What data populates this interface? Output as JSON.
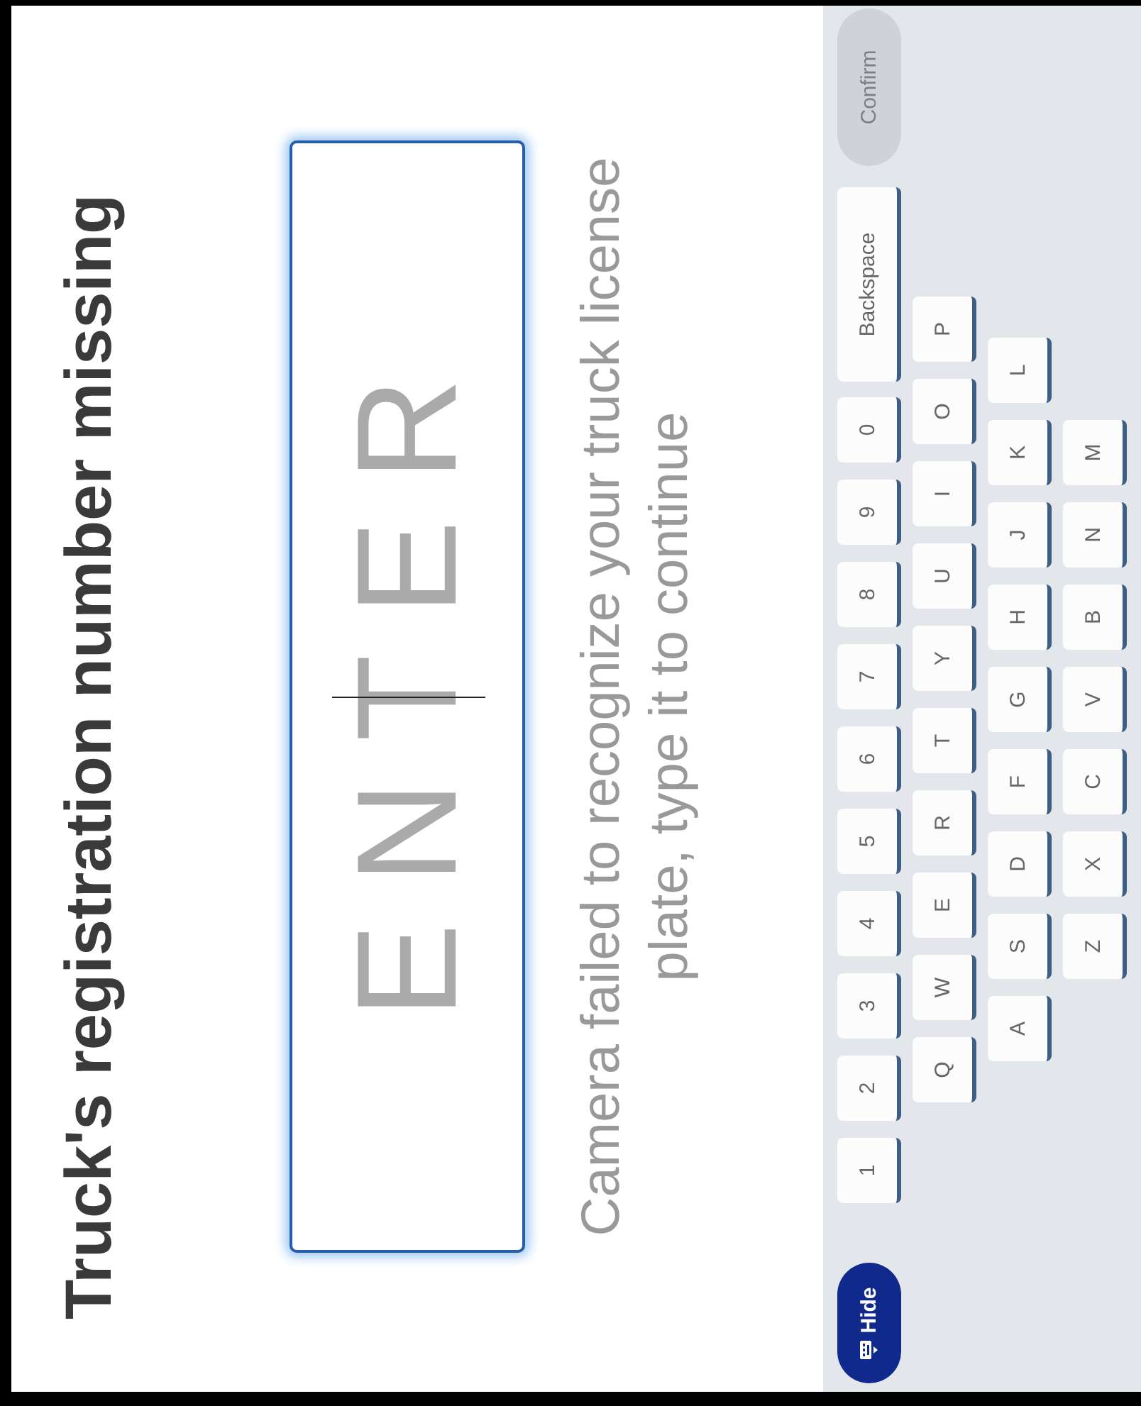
{
  "title": "Truck's registration number missing",
  "plate_field": {
    "placeholder": "ENTER",
    "focused": true
  },
  "message": "Camera failed to recognize your truck license plate, type it to continue",
  "keyboard": {
    "hide_button": {
      "label": "Hide"
    },
    "rows": [
      {
        "keys": [
          "1",
          "2",
          "3",
          "4",
          "5",
          "6",
          "7",
          "8",
          "9",
          "0"
        ]
      },
      {
        "keys": [
          "Q",
          "W",
          "E",
          "R",
          "T",
          "Y",
          "U",
          "I",
          "O",
          "P"
        ]
      },
      {
        "keys": [
          "A",
          "S",
          "D",
          "F",
          "G",
          "H",
          "J",
          "K",
          "L"
        ]
      },
      {
        "keys": [
          "Z",
          "X",
          "C",
          "V",
          "B",
          "N",
          "M"
        ]
      }
    ],
    "backspace": {
      "label": "Backspace"
    },
    "confirm": {
      "label": "Confirm",
      "disabled": true
    }
  }
}
